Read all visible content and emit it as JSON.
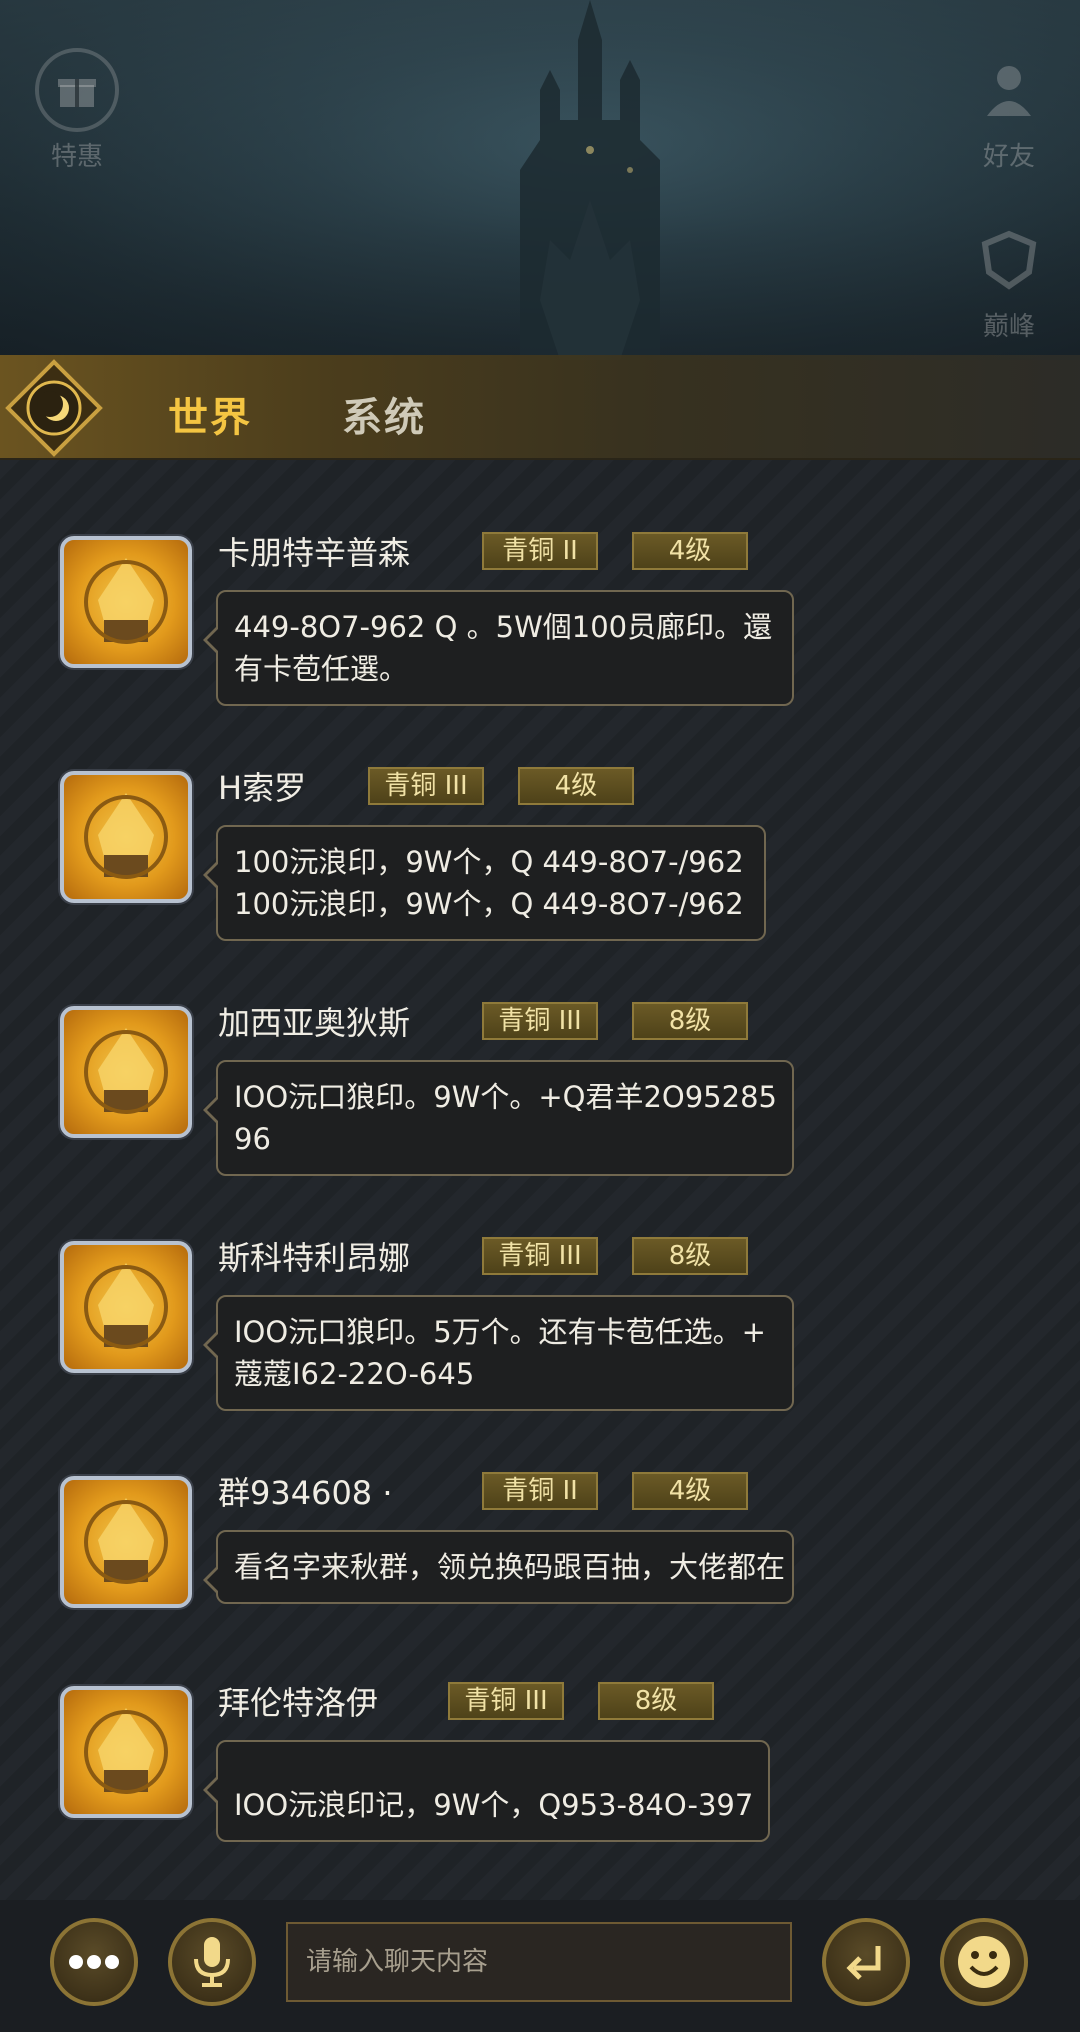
{
  "side_icons": [
    {
      "label": "特惠",
      "icon": "gift-icon"
    },
    {
      "label": "好友",
      "icon": "friends-icon"
    },
    {
      "label": "巅峰",
      "icon": "shield-icon"
    }
  ],
  "tabs": [
    {
      "label": "世界",
      "active": true
    },
    {
      "label": "系统",
      "active": false
    }
  ],
  "messages": [
    {
      "name": "卡朋特辛普森",
      "rank": "青铜 II",
      "level": "4级",
      "lines": [
        "449-8O7-962 Q 。5W個100员廊印。還",
        "有卡苞任選。"
      ]
    },
    {
      "name": "H索罗",
      "rank": "青铜 III",
      "level": "4级",
      "lines": [
        "100沅浪印，9W个，Q 449-8O7-/962",
        "100沅浪印，9W个，Q 449-8O7-/962"
      ]
    },
    {
      "name": "加西亚奥狄斯",
      "rank": "青铜 III",
      "level": "8级",
      "lines": [
        "IOO沅口狼印。9W个。+Q君羊2O95285",
        "96"
      ]
    },
    {
      "name": "斯科特利昂娜",
      "rank": "青铜 III",
      "level": "8级",
      "lines": [
        "IOO沅口狼印。5万个。还有卡苞任选。+",
        "蔻蔻I62-22O-645"
      ]
    },
    {
      "name": "群934608 ·",
      "rank": "青铜 II",
      "level": "4级",
      "lines": [
        "看名字来秋群，领兑换码跟百抽，大佬都在"
      ]
    },
    {
      "name": "拜伦特洛伊",
      "rank": "青铜 III",
      "level": "8级",
      "lines": [
        "IOO沅浪印记，9W个，Q953-84O-397"
      ]
    }
  ],
  "input": {
    "placeholder": "请输入聊天内容",
    "value": ""
  },
  "colors": {
    "accent": "#f4c542",
    "badge_border": "#8f7a3a",
    "bubble_border": "#716750"
  }
}
